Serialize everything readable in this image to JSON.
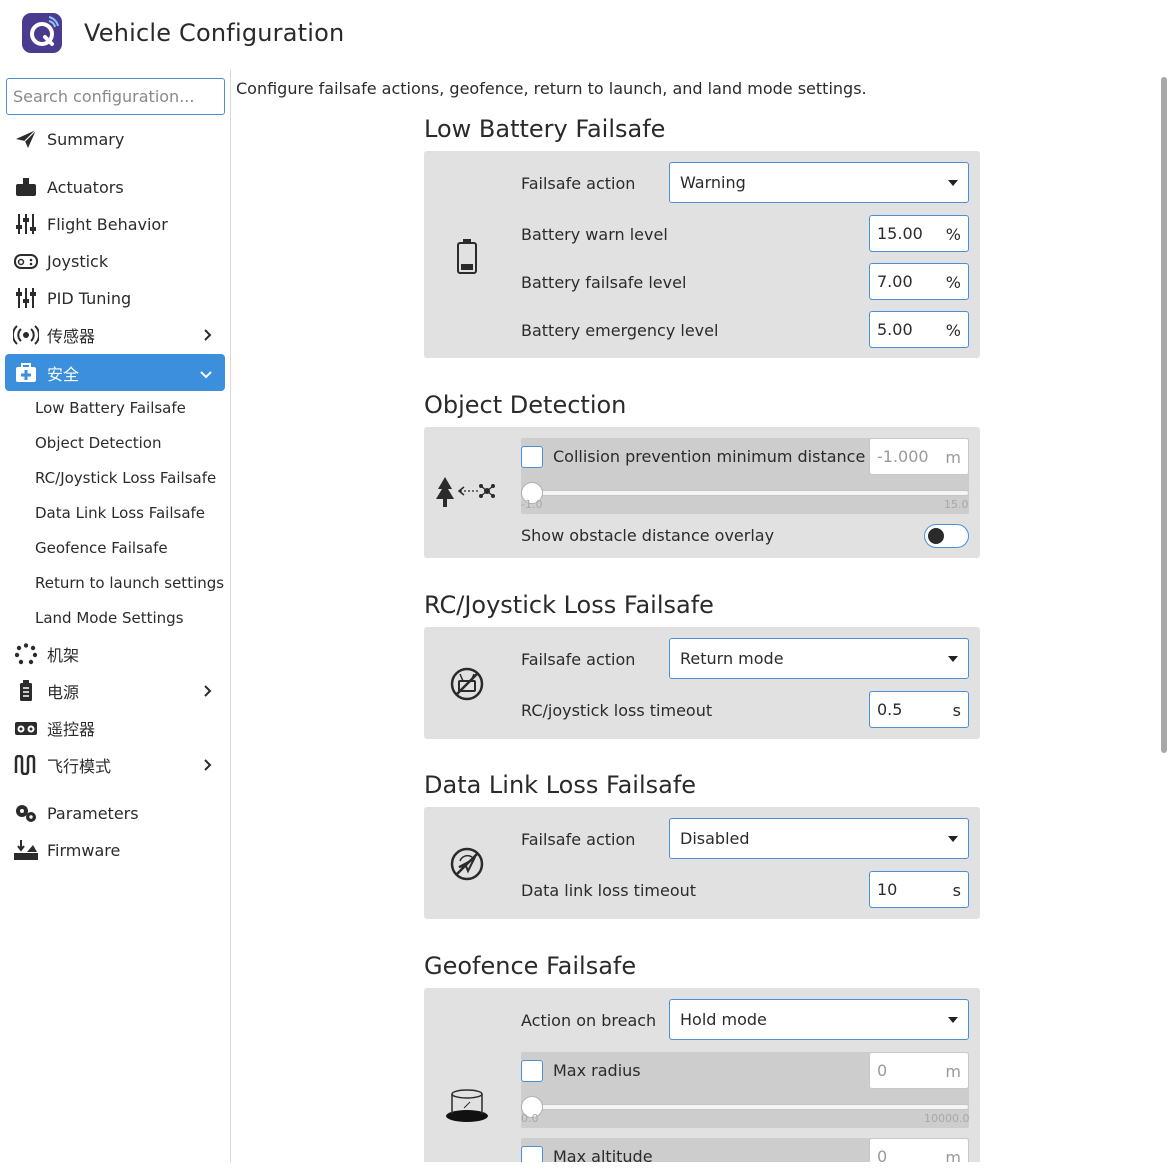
{
  "app": {
    "title": "Vehicle Configuration"
  },
  "sidebar": {
    "search_placeholder": "Search configuration...",
    "items": [
      {
        "label": "Summary",
        "icon": "paper-plane-icon"
      },
      {
        "label": "Actuators",
        "icon": "actuator-icon"
      },
      {
        "label": "Flight Behavior",
        "icon": "sliders-icon"
      },
      {
        "label": "Joystick",
        "icon": "gamepad-icon"
      },
      {
        "label": "PID Tuning",
        "icon": "sliders-icon"
      },
      {
        "label": "传感器",
        "icon": "radio-waves-icon"
      },
      {
        "label": "安全",
        "icon": "medkit-icon"
      },
      {
        "label": "机架",
        "icon": "airframe-icon"
      },
      {
        "label": "电源",
        "icon": "battery-icon"
      },
      {
        "label": "遥控器",
        "icon": "rc-icon"
      },
      {
        "label": "飞行模式",
        "icon": "flight-modes-icon"
      },
      {
        "label": "Parameters",
        "icon": "gears-icon"
      },
      {
        "label": "Firmware",
        "icon": "firmware-icon"
      }
    ],
    "sub_items": [
      "Low Battery Failsafe",
      "Object Detection",
      "RC/Joystick Loss Failsafe",
      "Data Link Loss Failsafe",
      "Geofence Failsafe",
      "Return to launch settings",
      "Land Mode Settings"
    ]
  },
  "main": {
    "intro": "Configure failsafe actions, geofence, return to launch, and land mode settings.",
    "low_battery": {
      "title": "Low Battery Failsafe",
      "action_label": "Failsafe action",
      "action_value": "Warning",
      "warn_label": "Battery warn level",
      "warn_value": "15.00",
      "failsafe_label": "Battery failsafe level",
      "failsafe_value": "7.00",
      "emergency_label": "Battery emergency level",
      "emergency_value": "5.00",
      "unit": "%"
    },
    "object_detection": {
      "title": "Object Detection",
      "collision_label": "Collision prevention minimum distance",
      "collision_value": "-1.000",
      "collision_unit": "m",
      "slider_min": "-1.0",
      "slider_max": "15.0",
      "overlay_label": "Show obstacle distance overlay"
    },
    "rc_loss": {
      "title": "RC/Joystick Loss Failsafe",
      "action_label": "Failsafe action",
      "action_value": "Return mode",
      "timeout_label": "RC/joystick loss timeout",
      "timeout_value": "0.5",
      "timeout_unit": "s"
    },
    "datalink_loss": {
      "title": "Data Link Loss Failsafe",
      "action_label": "Failsafe action",
      "action_value": "Disabled",
      "timeout_label": "Data link loss timeout",
      "timeout_value": "10",
      "timeout_unit": "s"
    },
    "geofence": {
      "title": "Geofence Failsafe",
      "breach_label": "Action on breach",
      "breach_value": "Hold mode",
      "radius_label": "Max radius",
      "radius_value": "0",
      "radius_unit": "m",
      "radius_min": "0.0",
      "radius_max": "10000.0",
      "altitude_label": "Max altitude",
      "altitude_value": "0",
      "altitude_unit": "m"
    }
  }
}
